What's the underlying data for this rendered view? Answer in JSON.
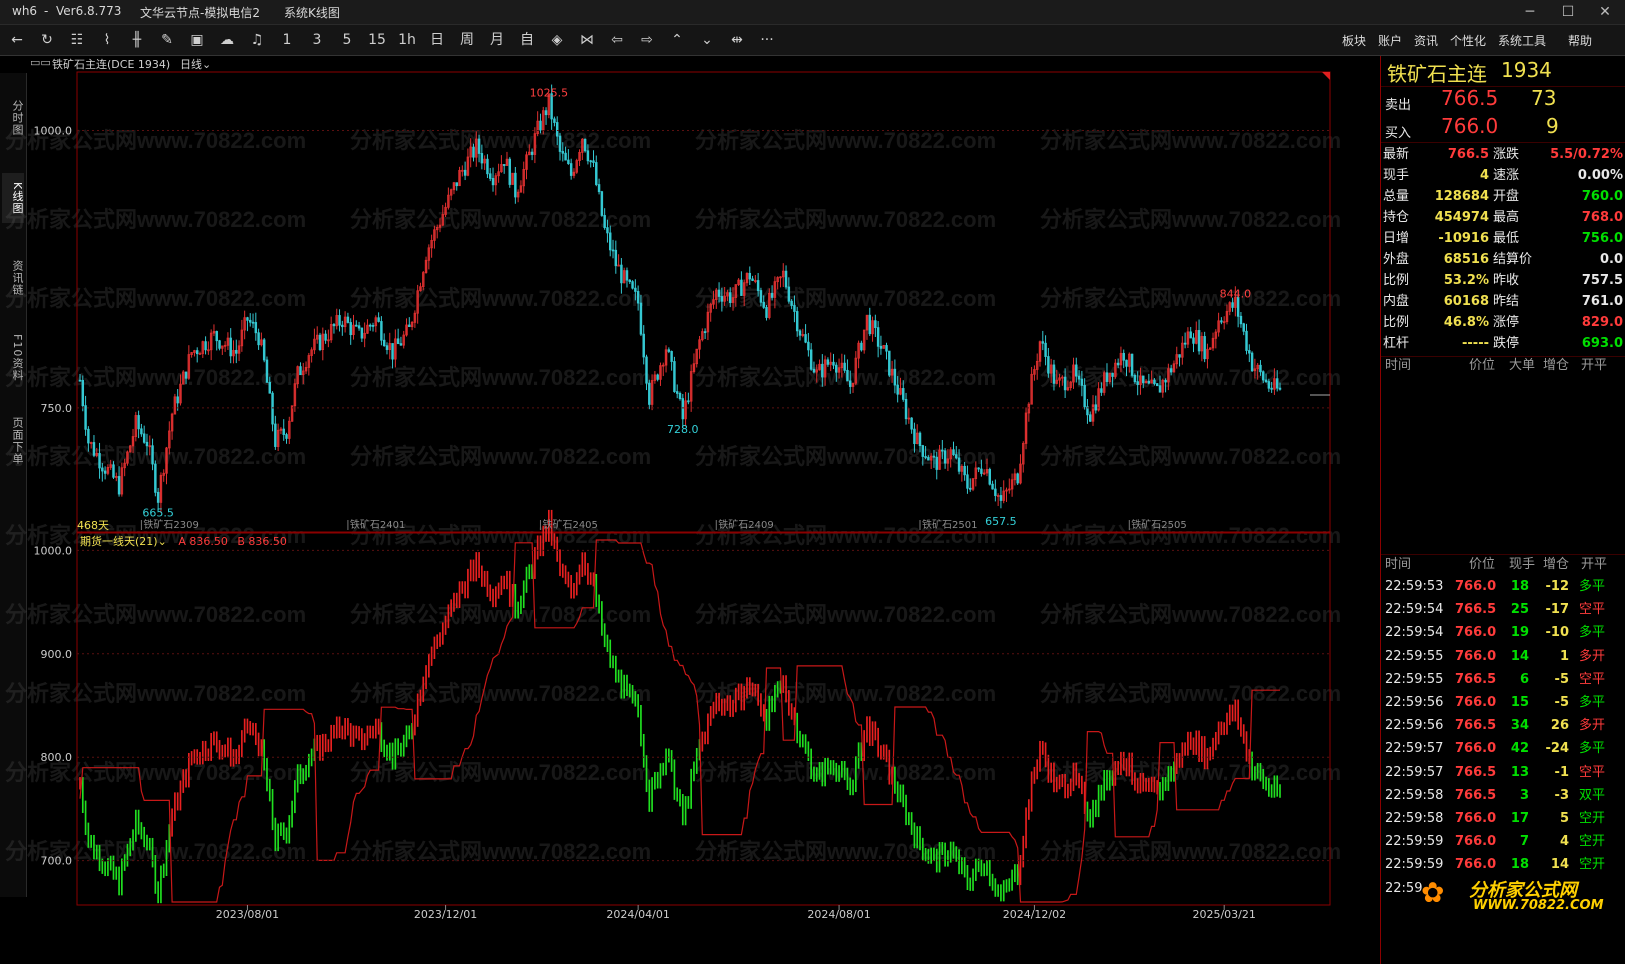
{
  "window": {
    "app": "wh6",
    "sep": "-",
    "version": "Ver6.8.773",
    "node": "文华云节点-模拟电信2",
    "view": "系统K线图",
    "min": "─",
    "max": "☐",
    "close": "✕"
  },
  "toolbar": {
    "periods": [
      "1",
      "3",
      "5",
      "15",
      "1h",
      "日",
      "周",
      "月",
      "自"
    ],
    "menus": [
      "板块",
      "账户",
      "资讯",
      "个性化",
      "系统工具",
      "帮助"
    ],
    "more": "···"
  },
  "left_tabs": [
    "分时图",
    "K线图",
    "资讯链",
    "F10资料",
    "页面下单"
  ],
  "chart": {
    "symbol_label": "铁矿石主连(DCE 1934)",
    "period_label": "日线",
    "high_label": "1025.5",
    "low_label_1": "665.5",
    "low_label_2": "728.0",
    "low_label_3": "657.5",
    "high_label_2": "844.0",
    "main_yticks": [
      "1000.0",
      "750.0"
    ],
    "days_label": "468天",
    "contract_marks": [
      "铁矿石2309",
      "铁矿石2401",
      "铁矿石2405",
      "铁矿石2409",
      "铁矿石2501",
      "铁矿石2505"
    ],
    "indicator_name": "期货一线天(21)",
    "indicator_a": "A 836.50",
    "indicator_b": "B 836.50",
    "sub_yticks": [
      "1000.0",
      "900.0",
      "800.0",
      "700.0"
    ],
    "date_ticks": [
      "2023/08/01",
      "2023/12/01",
      "2024/04/01",
      "2024/08/01",
      "2024/12/02",
      "2025/03/21"
    ],
    "watermark": "分析家公式网www.70822.com"
  },
  "chart_data": {
    "type": "candlestick",
    "xlabels": [
      "2023/08/01",
      "2023/12/01",
      "2024/04/01",
      "2024/08/01",
      "2024/12/02",
      "2025/03/21"
    ],
    "price_path": [
      [
        0,
        775
      ],
      [
        3,
        720
      ],
      [
        8,
        700
      ],
      [
        14,
        680
      ],
      [
        20,
        735
      ],
      [
        24,
        720
      ],
      [
        28,
        670
      ],
      [
        33,
        745
      ],
      [
        40,
        800
      ],
      [
        48,
        815
      ],
      [
        56,
        800
      ],
      [
        60,
        830
      ],
      [
        64,
        815
      ],
      [
        66,
        790
      ],
      [
        70,
        720
      ],
      [
        74,
        730
      ],
      [
        78,
        780
      ],
      [
        82,
        800
      ],
      [
        88,
        815
      ],
      [
        94,
        830
      ],
      [
        100,
        815
      ],
      [
        106,
        830
      ],
      [
        112,
        800
      ],
      [
        118,
        820
      ],
      [
        124,
        890
      ],
      [
        130,
        925
      ],
      [
        136,
        960
      ],
      [
        142,
        985
      ],
      [
        148,
        960
      ],
      [
        152,
        975
      ],
      [
        156,
        945
      ],
      [
        160,
        970
      ],
      [
        164,
        1000
      ],
      [
        168,
        1025
      ],
      [
        172,
        980
      ],
      [
        176,
        960
      ],
      [
        180,
        995
      ],
      [
        184,
        965
      ],
      [
        188,
        910
      ],
      [
        192,
        880
      ],
      [
        196,
        860
      ],
      [
        200,
        845
      ],
      [
        204,
        760
      ],
      [
        210,
        805
      ],
      [
        216,
        740
      ],
      [
        222,
        810
      ],
      [
        228,
        855
      ],
      [
        234,
        850
      ],
      [
        240,
        870
      ],
      [
        246,
        840
      ],
      [
        252,
        870
      ],
      [
        258,
        820
      ],
      [
        264,
        780
      ],
      [
        270,
        795
      ],
      [
        276,
        770
      ],
      [
        282,
        830
      ],
      [
        288,
        800
      ],
      [
        294,
        760
      ],
      [
        300,
        720
      ],
      [
        306,
        700
      ],
      [
        312,
        710
      ],
      [
        318,
        680
      ],
      [
        324,
        700
      ],
      [
        330,
        665
      ],
      [
        336,
        690
      ],
      [
        340,
        760
      ],
      [
        344,
        810
      ],
      [
        350,
        770
      ],
      [
        356,
        780
      ],
      [
        362,
        745
      ],
      [
        368,
        780
      ],
      [
        374,
        800
      ],
      [
        380,
        770
      ],
      [
        386,
        765
      ],
      [
        392,
        790
      ],
      [
        398,
        820
      ],
      [
        404,
        800
      ],
      [
        408,
        830
      ],
      [
        414,
        844
      ],
      [
        420,
        790
      ],
      [
        426,
        770
      ],
      [
        430,
        765
      ]
    ],
    "main_yrange": [
      640,
      1050
    ],
    "sub_yrange": [
      660,
      1010
    ]
  },
  "quote": {
    "name": "铁矿石主连",
    "code": "1934",
    "sell_label": "卖出",
    "sell_price": "766.5",
    "sell_vol": "73",
    "buy_label": "买入",
    "buy_price": "766.0",
    "buy_vol": "9",
    "left": [
      {
        "k": "最新",
        "v": "766.5",
        "c": "red"
      },
      {
        "k": "现手",
        "v": "4",
        "c": "yel"
      },
      {
        "k": "总量",
        "v": "128684",
        "c": "yel"
      },
      {
        "k": "持仓",
        "v": "454974",
        "c": "yel"
      },
      {
        "k": "日增",
        "v": "-10916",
        "c": "yel"
      },
      {
        "k": "外盘",
        "v": "68516",
        "c": "yel"
      },
      {
        "k": "比例",
        "v": "53.2%",
        "c": "yel"
      },
      {
        "k": "内盘",
        "v": "60168",
        "c": "yel"
      },
      {
        "k": "比例",
        "v": "46.8%",
        "c": "yel"
      },
      {
        "k": "杠杆",
        "v": "-----",
        "c": "yel"
      }
    ],
    "right": [
      {
        "k": "涨跌",
        "v": "5.5/0.72%",
        "c": "red"
      },
      {
        "k": "速涨",
        "v": "0.00%",
        "c": "white"
      },
      {
        "k": "开盘",
        "v": "760.0",
        "c": "green"
      },
      {
        "k": "最高",
        "v": "768.0",
        "c": "red"
      },
      {
        "k": "最低",
        "v": "756.0",
        "c": "green"
      },
      {
        "k": "结算价",
        "v": "0.0",
        "c": "white"
      },
      {
        "k": "昨收",
        "v": "757.5",
        "c": "white"
      },
      {
        "k": "昨结",
        "v": "761.0",
        "c": "white"
      },
      {
        "k": "涨停",
        "v": "829.0",
        "c": "red"
      },
      {
        "k": "跌停",
        "v": "693.0",
        "c": "green"
      }
    ],
    "big_header": [
      "时间",
      "价位",
      "大单",
      "增仓",
      "开平"
    ],
    "tick_header": [
      "时间",
      "价位",
      "现手",
      "增仓",
      "开平"
    ],
    "ticks": [
      [
        "22:59:53",
        "766.0",
        "18",
        "-12",
        "多平"
      ],
      [
        "22:59:54",
        "766.5",
        "25",
        "-17",
        "空平"
      ],
      [
        "22:59:54",
        "766.0",
        "19",
        "-10",
        "多平"
      ],
      [
        "22:59:55",
        "766.0",
        "14",
        "1",
        "多开"
      ],
      [
        "22:59:55",
        "766.5",
        "6",
        "-5",
        "空平"
      ],
      [
        "22:59:56",
        "766.0",
        "15",
        "-5",
        "多平"
      ],
      [
        "22:59:56",
        "766.5",
        "34",
        "26",
        "多开"
      ],
      [
        "22:59:57",
        "766.0",
        "42",
        "-24",
        "多平"
      ],
      [
        "22:59:57",
        "766.5",
        "13",
        "-1",
        "空平"
      ],
      [
        "22:59:58",
        "766.5",
        "3",
        "-3",
        "双平"
      ],
      [
        "22:59:58",
        "766.0",
        "17",
        "5",
        "空开"
      ],
      [
        "22:59:59",
        "766.0",
        "7",
        "4",
        "空开"
      ],
      [
        "22:59:59",
        "766.0",
        "18",
        "14",
        "空开"
      ],
      [
        "22:59",
        "",
        "",
        "",
        ""
      ]
    ],
    "logo_text": "分析家公式网",
    "logo_url": "WWW.70822.COM"
  }
}
